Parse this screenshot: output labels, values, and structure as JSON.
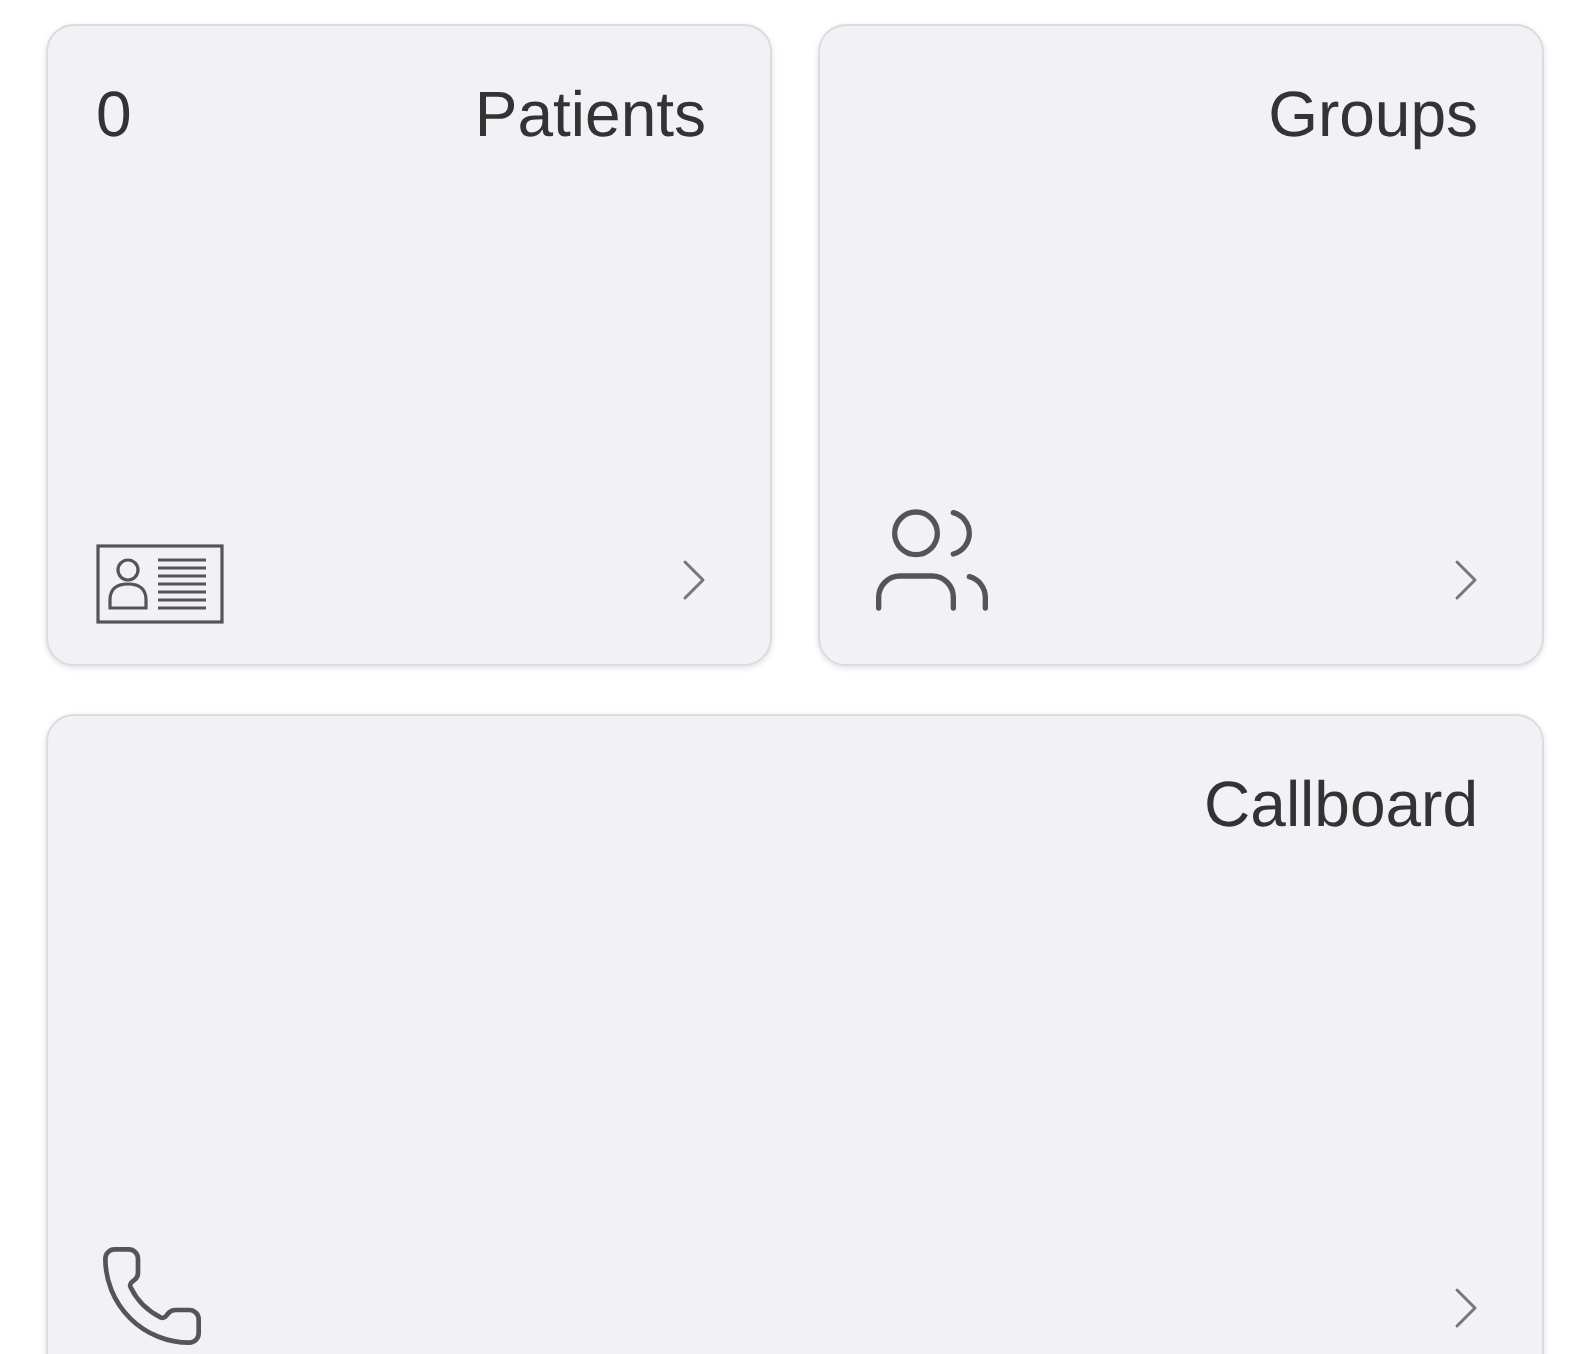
{
  "tiles": [
    {
      "kind": "patients",
      "count": "0",
      "title": "Patients"
    },
    {
      "kind": "groups",
      "title": "Groups"
    },
    {
      "kind": "callboard",
      "title": "Callboard"
    }
  ]
}
